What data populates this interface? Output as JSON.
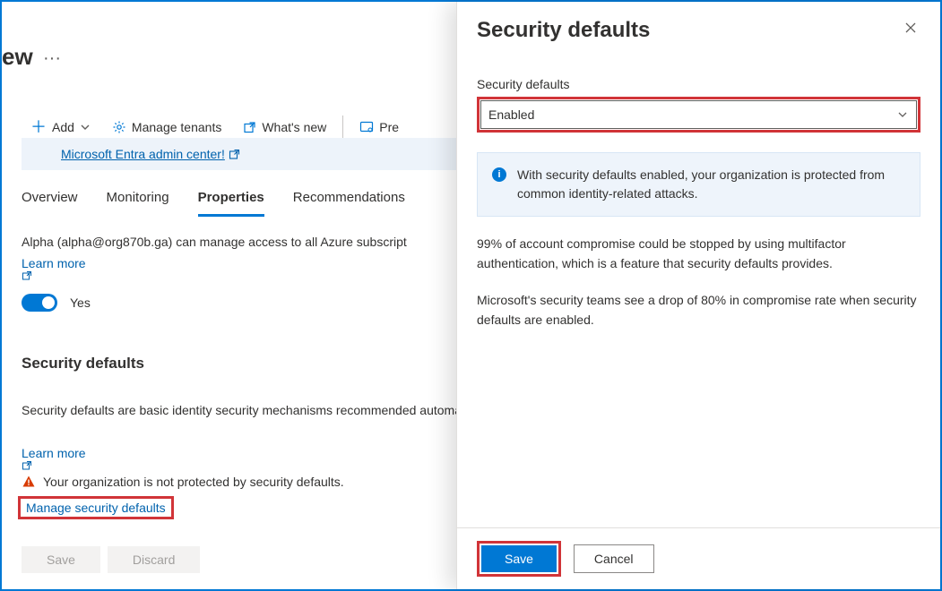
{
  "page": {
    "title": "ew"
  },
  "cmdbar": {
    "add": "Add",
    "manage_tenants": "Manage tenants",
    "whats_new": "What's new",
    "preview": "Pre"
  },
  "banner": {
    "link_text": "Microsoft Entra admin center!"
  },
  "tabs": [
    "Overview",
    "Monitoring",
    "Properties",
    "Recommendations"
  ],
  "main": {
    "access_text": "Alpha (alpha@org870b.ga) can manage access to all Azure subscript",
    "learn_more": "Learn more",
    "toggle_label": "Yes",
    "toggle_state": true,
    "sd_heading": "Security defaults",
    "sd_desc": "Security defaults are basic identity security mechanisms recommended automatically enforced in your organization. Administrators and user",
    "warning_text": "Your organization is not protected by security defaults.",
    "manage_link": "Manage security defaults",
    "footer": {
      "save": "Save",
      "discard": "Discard"
    }
  },
  "panel": {
    "title": "Security defaults",
    "field_label": "Security defaults",
    "select_value": "Enabled",
    "info_text": "With security defaults enabled, your organization is protected from common identity-related attacks.",
    "p1": "99% of account compromise could be stopped by using multifactor authentication, which is a feature that security defaults provides.",
    "p2": "Microsoft's security teams see a drop of 80% in compromise rate when security defaults are enabled.",
    "footer": {
      "save": "Save",
      "cancel": "Cancel"
    }
  },
  "colors": {
    "accent": "#0078d4",
    "highlight": "#d13438",
    "warn": "#d83b01"
  }
}
